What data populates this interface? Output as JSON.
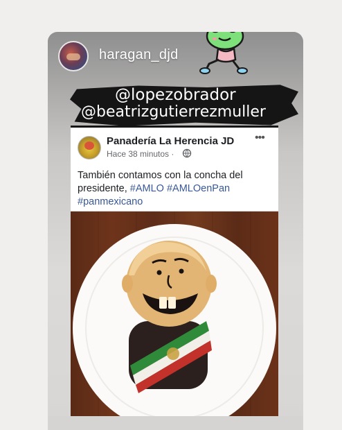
{
  "story": {
    "username": "haragan_djd",
    "mentions": [
      "@lopezobrador",
      "@beatrizgutierrezmuller"
    ]
  },
  "post": {
    "page_name": "Panadería La Herencia JD",
    "time": "Hace 38 minutos ·",
    "text_plain": "También contamos con la concha del presidente,",
    "hashtags": [
      "#AMLO",
      "#AMLOenPan",
      "#panmexicano"
    ]
  },
  "colors": {
    "hashtag": "#385898",
    "brush": "#151515",
    "table": "#6a3119",
    "plate": "#ffffff",
    "sash_green": "#2f8a3a",
    "sash_white": "#f2efe8",
    "sash_red": "#c2322b"
  },
  "icons": {
    "more": "ellipsis-icon",
    "privacy": "globe-icon",
    "sticker": "frog-running-sticker"
  }
}
